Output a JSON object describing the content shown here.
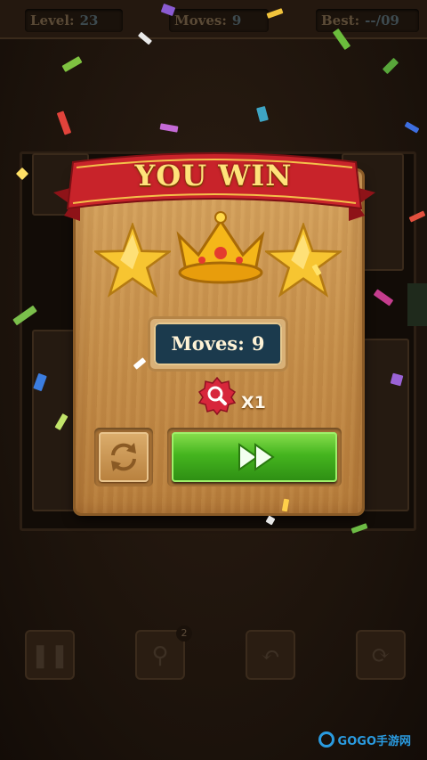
{
  "hud": {
    "level_label": "Level:",
    "level_value": "23",
    "moves_label": "Moves:",
    "moves_value": "9",
    "best_label": "Best:",
    "best_value": "--/09"
  },
  "dialog": {
    "title": "YOU WIN",
    "stars_earned": 3,
    "moves_label": "Moves:",
    "moves_value": "9",
    "hint_count": "X1"
  },
  "toolbar": {
    "hint_badge": "2",
    "buttons": [
      "pause-icon",
      "magnifier-icon",
      "undo-icon",
      "restart-icon"
    ]
  },
  "watermark": "GOGO手游网",
  "colors": {
    "ribbon": "#c8232a",
    "title_gold": "#ffe27a",
    "next_green": "#45b51f",
    "moves_plate": "#1b3a4d"
  }
}
